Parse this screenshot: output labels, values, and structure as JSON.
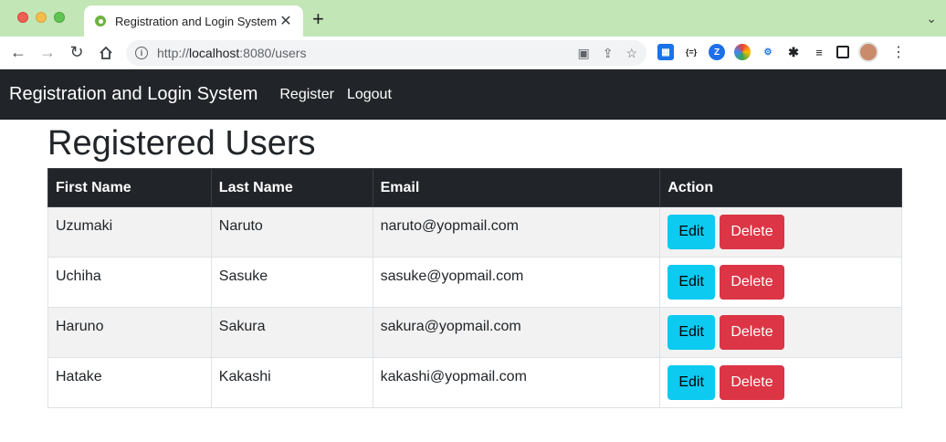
{
  "browser": {
    "tab_title": "Registration and Login System",
    "tab_close": "✕",
    "new_tab": "+",
    "url_host": "localhost",
    "url_prefix": "http://",
    "url_suffix": ":8080/users",
    "icons": [
      "back-icon",
      "forward-icon",
      "reload-icon",
      "home-icon",
      "info-icon",
      "translate-icon",
      "share-icon",
      "star-icon",
      "extension-icon",
      "reading-list-icon",
      "side-panel-icon",
      "profile-avatar",
      "menu-icon"
    ]
  },
  "navbar": {
    "brand": "Registration and Login System",
    "links": [
      "Register",
      "Logout"
    ]
  },
  "page": {
    "title": "Registered Users"
  },
  "table": {
    "headers": [
      "First Name",
      "Last Name",
      "Email",
      "Action"
    ],
    "rows": [
      {
        "first": "Uzumaki",
        "last": "Naruto",
        "email": "naruto@yopmail.com"
      },
      {
        "first": "Uchiha",
        "last": "Sasuke",
        "email": "sasuke@yopmail.com"
      },
      {
        "first": "Haruno",
        "last": "Sakura",
        "email": "sakura@yopmail.com"
      },
      {
        "first": "Hatake",
        "last": "Kakashi",
        "email": "kakashi@yopmail.com"
      }
    ],
    "edit_label": "Edit",
    "delete_label": "Delete"
  },
  "colors": {
    "navbar_bg": "#212529",
    "edit_button": "#0dcaf0",
    "delete_button": "#dc3545",
    "tab_strip": "#c3e6b6"
  }
}
